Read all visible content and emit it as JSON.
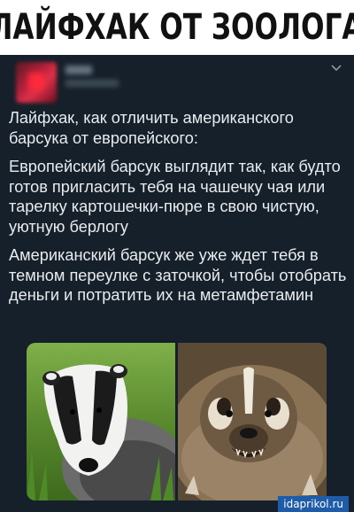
{
  "banner": {
    "title": "ЛАЙФХАК ОТ ЗООЛОГА"
  },
  "tweet": {
    "paragraphs": [
      "Лайфхак, как отличить американского барсука от европейского:",
      "Европейский барсук выглядит так, как будто готов пригласить тебя на чашечку чая или тарелку картошечки-пюре в свою чистую, уютную берлогу",
      "Американский барсук же уже ждет тебя в темном переулке с заточкой, чтобы отобрать деньги и потратить их на метамфетамин"
    ]
  },
  "photos": [
    {
      "subject": "european-badger"
    },
    {
      "subject": "american-badger"
    }
  ],
  "watermark": "idaprikol.ru",
  "colors": {
    "background": "#16202a",
    "text": "#e8ecef",
    "banner": "#ffffff",
    "watermark_bg": "#1e5ba8"
  }
}
